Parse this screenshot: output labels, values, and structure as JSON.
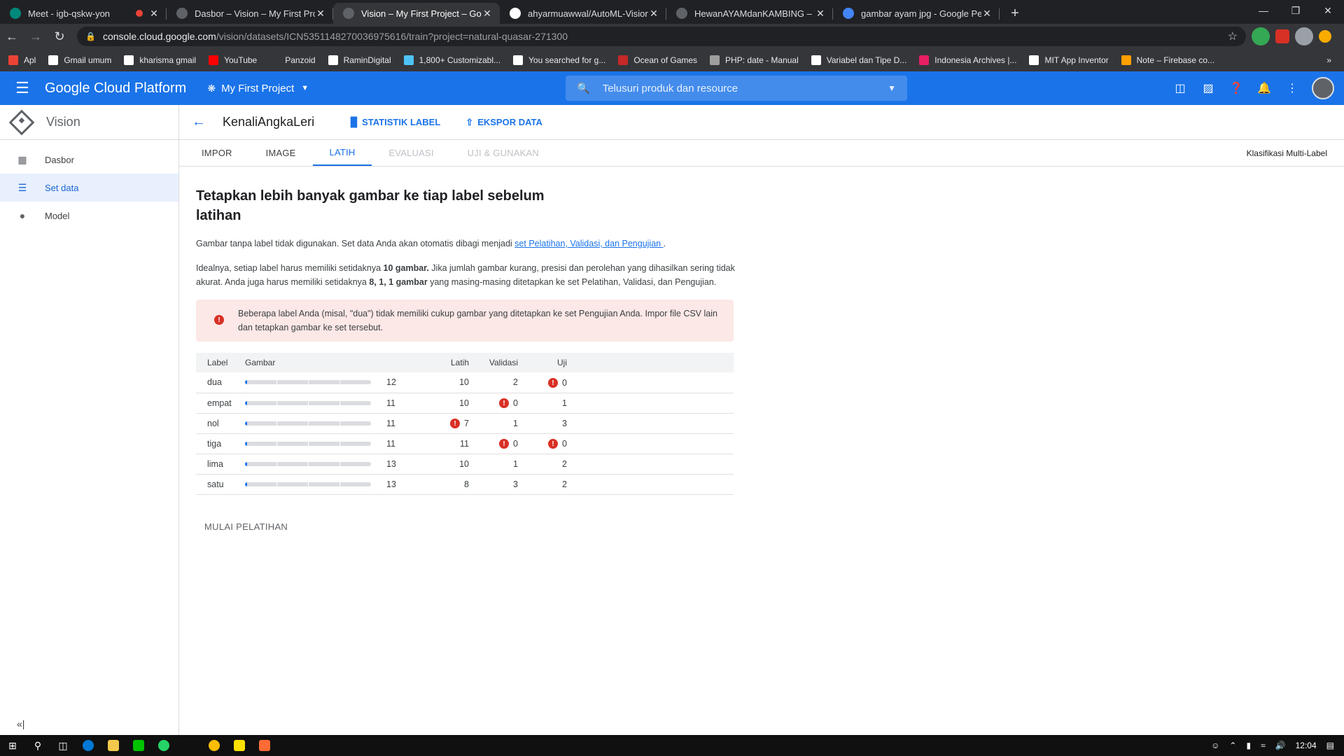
{
  "browser": {
    "tabs": [
      {
        "title": "Meet - igb-qskw-yon",
        "color": "#00897b",
        "recording": true
      },
      {
        "title": "Dasbor – Vision – My First Projec",
        "color": "#5f6368"
      },
      {
        "title": "Vision – My First Project – Googl",
        "color": "#5f6368",
        "active": true
      },
      {
        "title": "ahyarmuawwal/AutoML-Vision-G",
        "color": "#ffffff"
      },
      {
        "title": "HewanAYAMdanKAMBING – Visi",
        "color": "#5f6368"
      },
      {
        "title": "gambar ayam jpg - Google Pene",
        "color": "#4285f4"
      }
    ],
    "url_host": "console.cloud.google.com",
    "url_path": "/vision/datasets/ICN5351148270036975616/train?project=natural-quasar-271300",
    "bookmarks": [
      {
        "label": "Apl",
        "color": "#ea4335"
      },
      {
        "label": "Gmail umum",
        "color": "#ffffff"
      },
      {
        "label": "kharisma gmail",
        "color": "#ffffff"
      },
      {
        "label": "YouTube",
        "color": "#ff0000"
      },
      {
        "label": "Panzoid",
        "color": "#35363a"
      },
      {
        "label": "RaminDigital",
        "color": "#ffffff"
      },
      {
        "label": "1,800+ Customizabl...",
        "color": "#4fc3f7"
      },
      {
        "label": "You searched for g...",
        "color": "#ffffff"
      },
      {
        "label": "Ocean of Games",
        "color": "#c62828"
      },
      {
        "label": "PHP: date - Manual",
        "color": "#9e9e9e"
      },
      {
        "label": "Variabel dan Tipe D...",
        "color": "#ffffff"
      },
      {
        "label": "Indonesia Archives |...",
        "color": "#e91e63"
      },
      {
        "label": "MIT App Inventor",
        "color": "#ffffff"
      },
      {
        "label": "Note – Firebase co...",
        "color": "#ffa000"
      }
    ]
  },
  "gcp": {
    "brand": "Google Cloud Platform",
    "project": "My First Project",
    "search_placeholder": "Telusuri produk dan resource"
  },
  "sidebar": {
    "title": "Vision",
    "items": [
      {
        "label": "Dasbor",
        "icon": "dashboard-icon"
      },
      {
        "label": "Set data",
        "icon": "list-icon",
        "active": true
      },
      {
        "label": "Model",
        "icon": "bulb-icon"
      }
    ]
  },
  "main": {
    "dataset_name": "KenaliAngkaLeri",
    "actions": [
      "STATISTIK LABEL",
      "EKSPOR DATA"
    ],
    "tabs": [
      {
        "label": "IMPOR"
      },
      {
        "label": "IMAGE"
      },
      {
        "label": "LATIH",
        "active": true
      },
      {
        "label": "EVALUASI",
        "disabled": true
      },
      {
        "label": "UJI & GUNAKAN",
        "disabled": true
      }
    ],
    "classification": "Klasifikasi Multi-Label",
    "heading": "Tetapkan lebih banyak gambar ke tiap label sebelum latihan",
    "para1_text": "Gambar tanpa label tidak digunakan. Set data Anda akan otomatis dibagi menjadi ",
    "para1_link": "set Pelatihan, Validasi, dan Pengujian ",
    "para1_end": ".",
    "para2_a": "Idealnya, setiap label harus memiliki setidaknya ",
    "para2_b": "10 gambar.",
    "para2_c": " Jika jumlah gambar kurang, presisi dan perolehan yang dihasilkan sering tidak akurat. Anda juga harus memiliki setidaknya ",
    "para2_d": "8, 1, 1 gambar",
    "para2_e": " yang masing-masing ditetapkan ke set Pelatihan, Validasi, dan Pengujian.",
    "alert": "Beberapa label Anda (misal, \"dua\") tidak memiliki cukup gambar yang ditetapkan ke set Pengujian Anda. Impor file CSV lain dan tetapkan gambar ke set tersebut.",
    "table": {
      "headers": [
        "Label",
        "Gambar",
        "Latih",
        "Validasi",
        "Uji"
      ],
      "rows": [
        {
          "label": "dua",
          "images": 12,
          "train": 10,
          "validation": 2,
          "test": 0,
          "warn": [
            "test"
          ]
        },
        {
          "label": "empat",
          "images": 11,
          "train": 10,
          "validation": 0,
          "test": 1,
          "warn": [
            "validation"
          ]
        },
        {
          "label": "nol",
          "images": 11,
          "train": 7,
          "validation": 1,
          "test": 3,
          "warn": [
            "train"
          ]
        },
        {
          "label": "tiga",
          "images": 11,
          "train": 11,
          "validation": 0,
          "test": 0,
          "warn": [
            "validation",
            "test"
          ]
        },
        {
          "label": "lima",
          "images": 13,
          "train": 10,
          "validation": 1,
          "test": 2,
          "warn": []
        },
        {
          "label": "satu",
          "images": 13,
          "train": 8,
          "validation": 3,
          "test": 2,
          "warn": []
        }
      ]
    },
    "start_button": "MULAI PELATIHAN"
  },
  "taskbar": {
    "time": "12:04"
  },
  "colors": {
    "brand_blue": "#1a73e8",
    "error_red": "#d93025",
    "alert_bg": "#fce8e6"
  }
}
